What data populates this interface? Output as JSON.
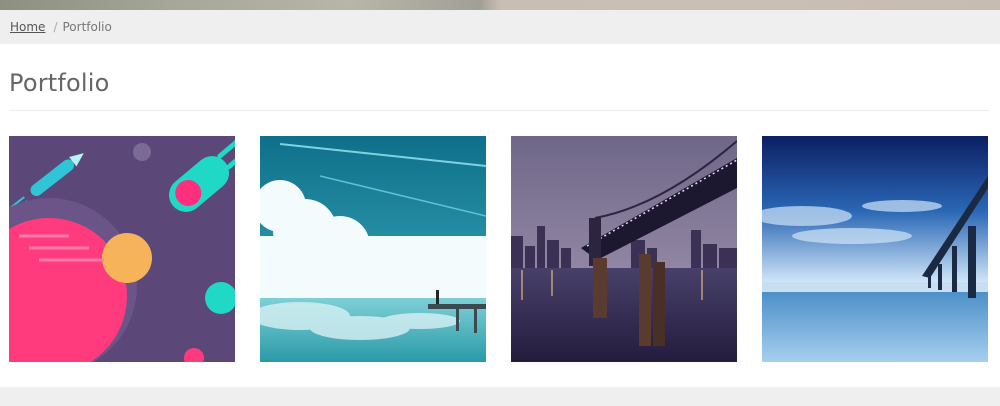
{
  "breadcrumb": {
    "home_label": "Home",
    "separator": "/",
    "current_label": "Portfolio"
  },
  "page": {
    "title": "Portfolio"
  },
  "gallery": {
    "items": [
      {
        "subject": "flat-space-illustration"
      },
      {
        "subject": "clouds-over-sea-pier"
      },
      {
        "subject": "bridge-city-night"
      },
      {
        "subject": "pier-beach-sky"
      }
    ]
  }
}
